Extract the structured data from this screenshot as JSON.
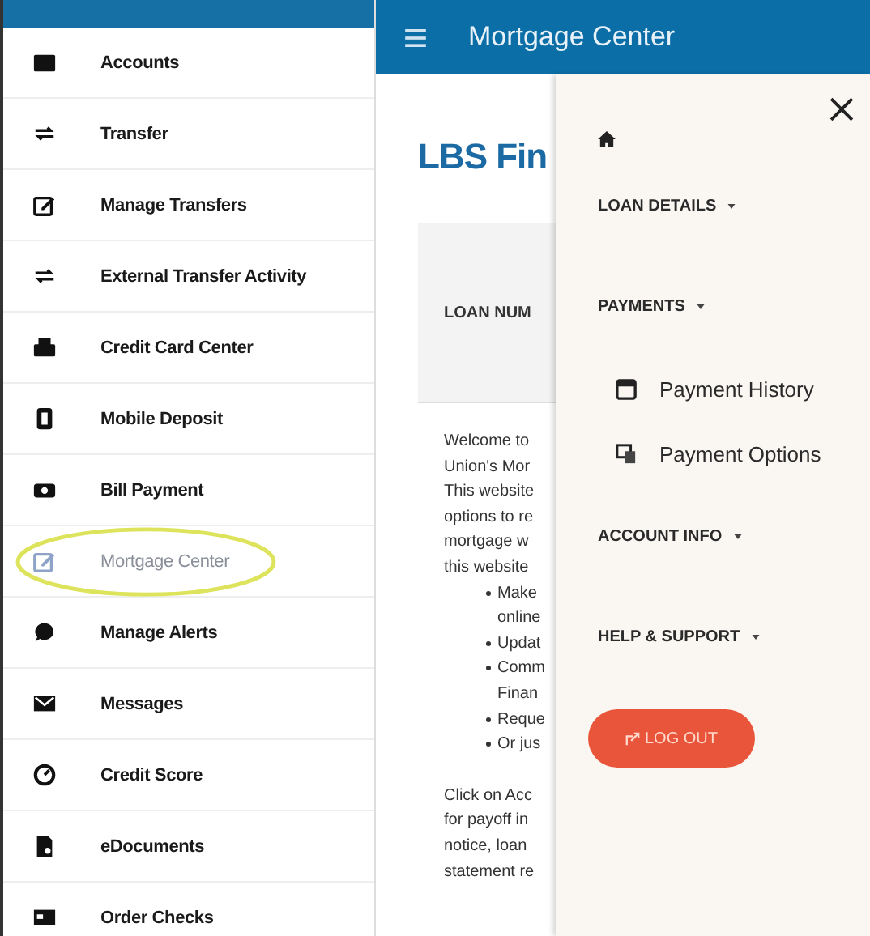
{
  "sidebar": {
    "items": [
      {
        "label": "Accounts",
        "selected": false
      },
      {
        "label": "Transfer",
        "selected": false
      },
      {
        "label": "Manage Transfers",
        "selected": false
      },
      {
        "label": "External Transfer Activity",
        "selected": false
      },
      {
        "label": "Credit Card Center",
        "selected": false
      },
      {
        "label": "Mobile Deposit",
        "selected": false
      },
      {
        "label": "Bill Payment",
        "selected": false
      },
      {
        "label": "Mortgage Center",
        "selected": true
      },
      {
        "label": "Manage Alerts",
        "selected": false
      },
      {
        "label": "Messages",
        "selected": false
      },
      {
        "label": "Credit Score",
        "selected": false
      },
      {
        "label": "eDocuments",
        "selected": false
      },
      {
        "label": "Order Checks",
        "selected": false
      }
    ]
  },
  "header": {
    "title": "Mortgage Center"
  },
  "main": {
    "heading": "LBS Fin",
    "card_label": "LOAN NUM",
    "intro_lines": [
      "Welcome to",
      "Union's Mor",
      "This website",
      "options to re",
      "mortgage w",
      "this website"
    ],
    "bullets": [
      [
        "Make",
        "online"
      ],
      [
        "Updat"
      ],
      [
        "Comm",
        "Finan"
      ],
      [
        "Reque"
      ],
      [
        "Or jus"
      ]
    ],
    "outro_lines": [
      "Click on Acc",
      "for payoff in",
      "notice, loan",
      "statement re"
    ]
  },
  "drawer": {
    "items": [
      {
        "kind": "home"
      },
      {
        "kind": "section",
        "label": "LOAN DETAILS"
      },
      {
        "kind": "section",
        "label": "PAYMENTS"
      },
      {
        "kind": "link",
        "label": "Payment History"
      },
      {
        "kind": "link",
        "label": "Payment Options"
      },
      {
        "kind": "section",
        "label": "ACCOUNT INFO"
      },
      {
        "kind": "section",
        "label": "HELP & SUPPORT"
      }
    ],
    "logout": "LOG OUT"
  }
}
